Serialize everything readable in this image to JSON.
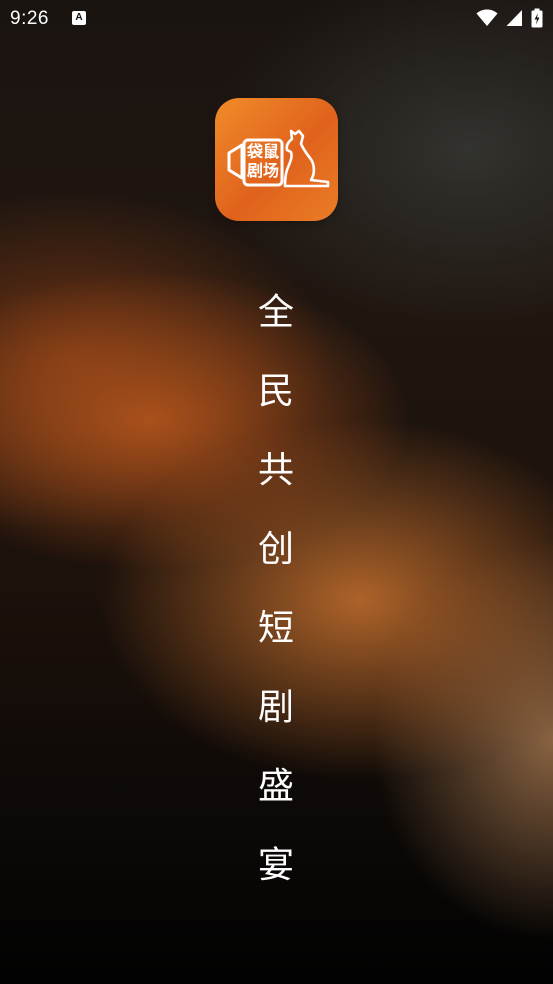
{
  "status_bar": {
    "time": "9:26",
    "notification_icon": "a-letter-icon",
    "notification_glyph": "A",
    "icons": [
      "wifi-icon",
      "cellular-signal-icon",
      "battery-charging-icon"
    ]
  },
  "app_logo": {
    "icon": "kangaroo-camera-logo",
    "chars": [
      "袋",
      "鼠",
      "剧",
      "场"
    ],
    "bg_colors": [
      "#f08c2a",
      "#e0621c"
    ]
  },
  "slogan": {
    "chars": [
      "全",
      "民",
      "共",
      "创",
      "短",
      "剧",
      "盛",
      "宴"
    ]
  },
  "colors": {
    "text": "#ffffff",
    "accent": "#e8741f"
  }
}
